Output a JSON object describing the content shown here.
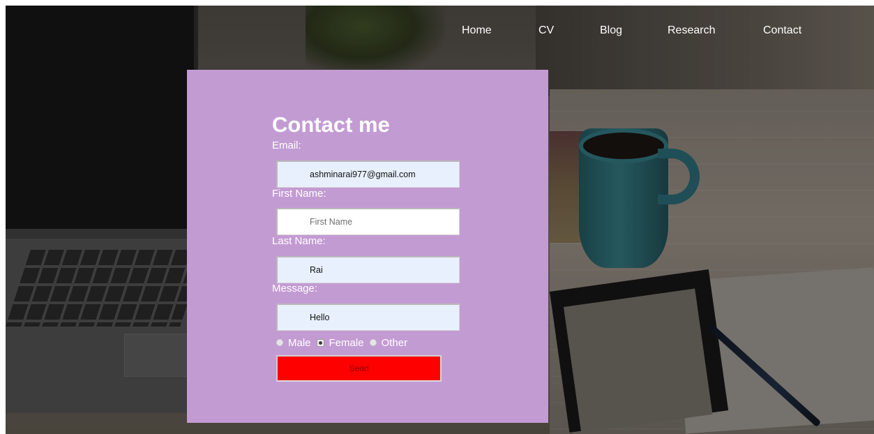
{
  "nav": {
    "home": "Home",
    "cv": "CV",
    "blog": "Blog",
    "research": "Research",
    "contact": "Contact"
  },
  "form": {
    "title": "Contact me",
    "email_label": "Email:",
    "email_value": "ashminarai977@gmail.com",
    "first_name_label": "First Name:",
    "first_name_value": "",
    "first_name_placeholder": "First Name",
    "last_name_label": "Last Name:",
    "last_name_value": "Rai",
    "message_label": "Message:",
    "message_value": "Hello",
    "gender_options": [
      "Male",
      "Female",
      "Other"
    ],
    "gender_selected": "Female",
    "send_label": "Send"
  },
  "colors": {
    "card_background": "#c39bd3",
    "send_button": "#ff0000",
    "autofill_field": "#e8f0fe",
    "text_on_card": "#ffffff"
  }
}
